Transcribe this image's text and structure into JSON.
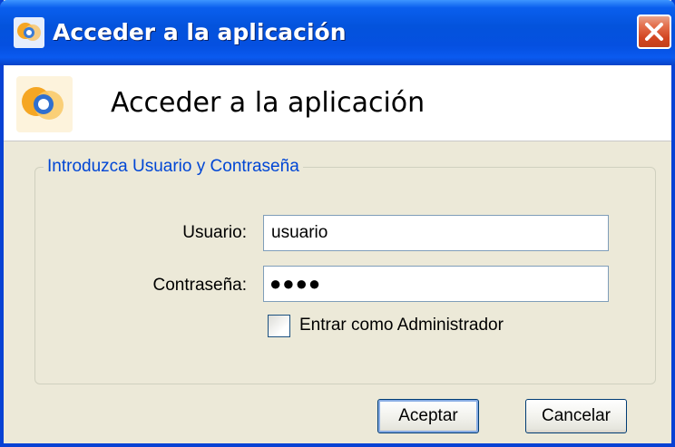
{
  "window": {
    "title": "Acceder a la aplicación",
    "icons": {
      "app": "app-logo-icon",
      "close": "close-icon"
    }
  },
  "header": {
    "title": "Acceder a la aplicación"
  },
  "form": {
    "group_title": "Introduzca Usuario y Contraseña",
    "username_label": "Usuario:",
    "username_value": "usuario",
    "password_label": "Contraseña:",
    "password_value": "●●●●",
    "admin_checkbox_label": "Entrar como Administrador",
    "admin_checked": false
  },
  "buttons": {
    "accept": "Aceptar",
    "cancel": "Cancelar"
  },
  "colors": {
    "titlebar": "#0453DC",
    "group_title": "#0046D5",
    "close_button": "#D24622",
    "dialog_background": "#ECE9D8"
  }
}
